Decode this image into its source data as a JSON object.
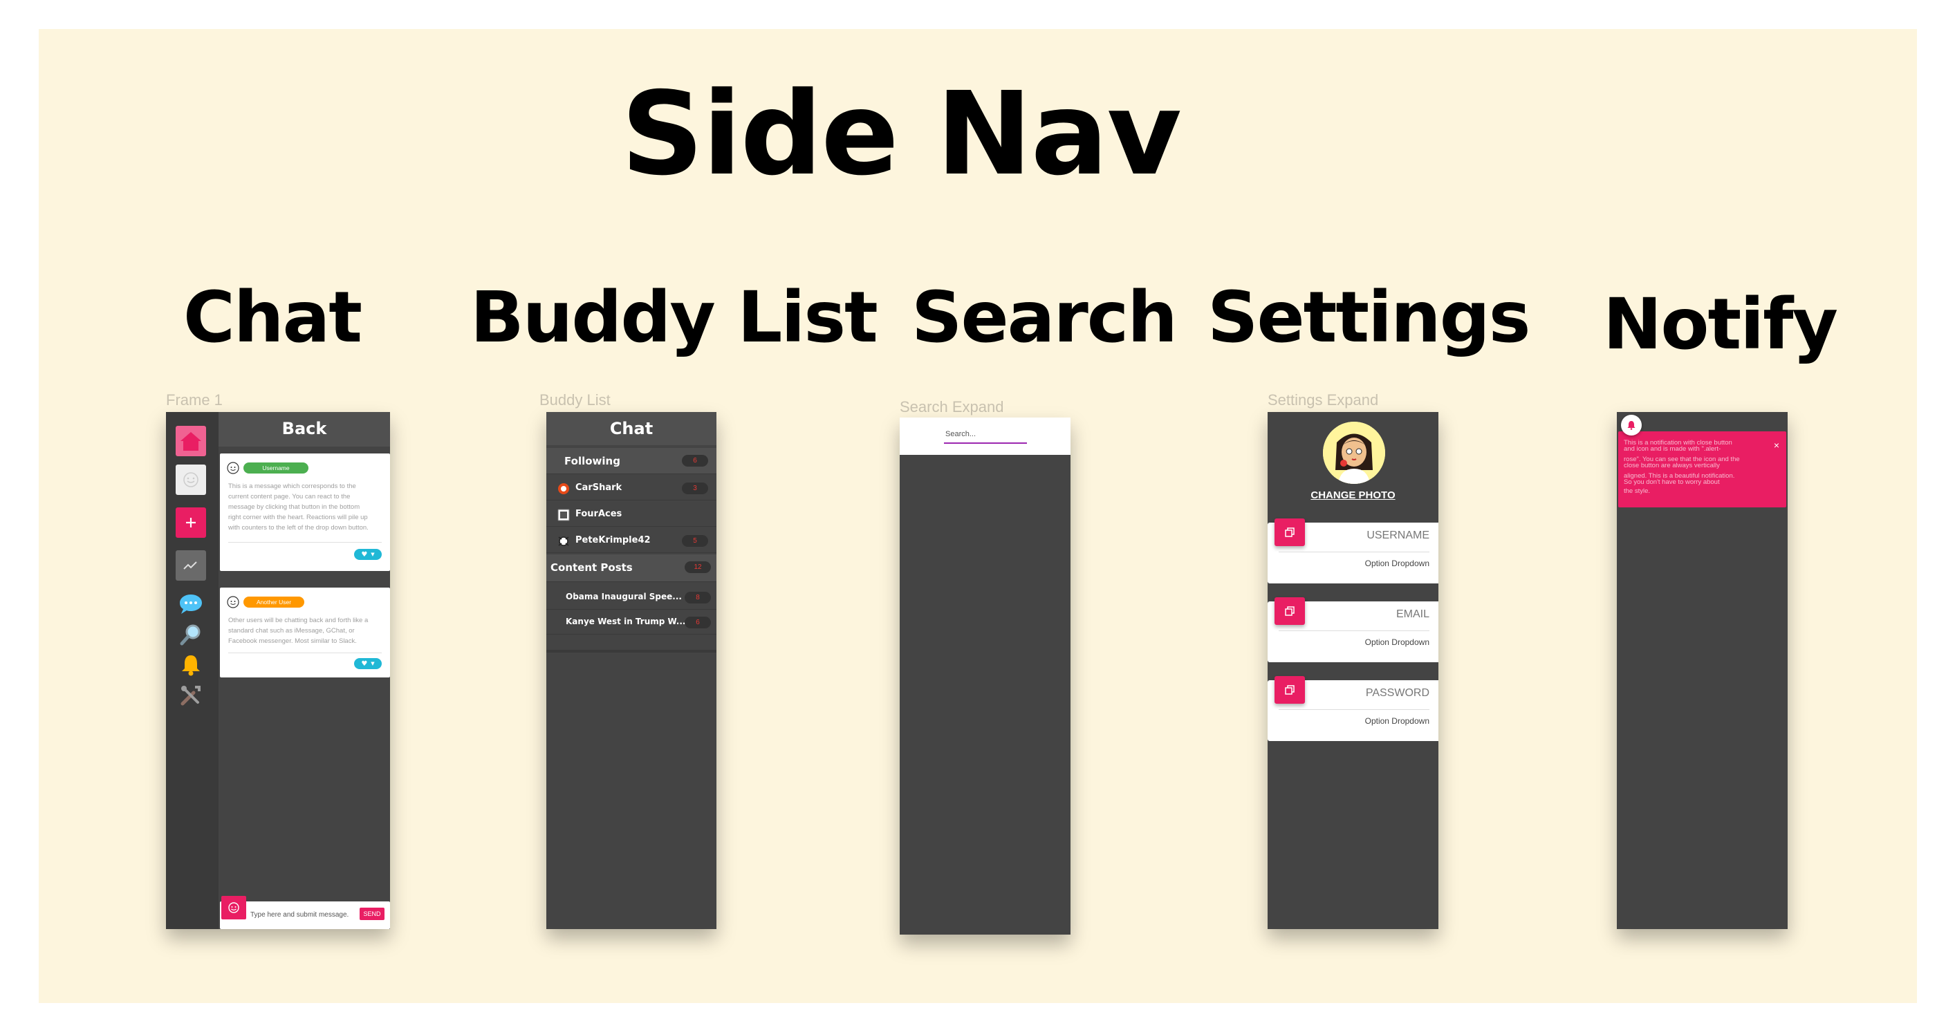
{
  "title": "Side Nav",
  "sections": {
    "chat": "Chat",
    "buddy": "Buddy List",
    "search": "Search",
    "settings": "Settings",
    "notify": "Notify"
  },
  "frames": {
    "chat": "Frame 1",
    "buddy": "Buddy List",
    "search": "Search Expand",
    "settings": "Settings Expand"
  },
  "chat_panel": {
    "back_label": "Back",
    "rail_icons": [
      "home-icon",
      "avatar",
      "plus-icon",
      "chart-icon",
      "speech-bubble-icon",
      "magnifier-icon",
      "bell-icon",
      "tools-icon"
    ],
    "messages": [
      {
        "user": "Username",
        "user_color": "#4caf50",
        "lines": [
          "This is a message which corresponds to the",
          "current content page.  You can react to the",
          "message by clicking that button in the bottom",
          "right corner with the heart. Reactions will pile up",
          "with counters to the left of the drop down button."
        ]
      },
      {
        "user": "Another User",
        "user_color": "#ff9800",
        "lines": [
          "Other users will be chatting back and forth like a",
          "standard chat such as iMessage, GChat, or",
          "Facebook messenger. Most similar to Slack."
        ]
      }
    ],
    "input_placeholder": "Type here and submit message.",
    "send_label": "SEND"
  },
  "buddy_panel": {
    "header": "Chat",
    "following": {
      "label": "Following",
      "count": "6"
    },
    "buddies": [
      {
        "name": "CarShark",
        "count": "3"
      },
      {
        "name": "FourAces",
        "count": ""
      },
      {
        "name": "PeteKrimple42",
        "count": "5"
      }
    ],
    "content": {
      "label": "Content Posts",
      "count": "12"
    },
    "posts": [
      {
        "title": "Obama Inaugural Spee...",
        "count": "8"
      },
      {
        "title": "Kanye West in Trump W...",
        "count": "6"
      }
    ]
  },
  "search_panel": {
    "placeholder": "Search..."
  },
  "settings_panel": {
    "change_photo": "CHANGE PHOTO",
    "fields": [
      {
        "label": "USERNAME",
        "option": "Option Dropdown"
      },
      {
        "label": "EMAIL",
        "option": "Option Dropdown"
      },
      {
        "label": "PASSWORD",
        "option": "Option Dropdown"
      }
    ]
  },
  "notify_panel": {
    "lines": [
      "This is a notification with close button",
      "and icon and is made with \".alert-",
      "rose\". You can see that the icon and the",
      "close button are always vertically",
      "aligned. This is a beautiful notification.",
      "So you don't have to worry about",
      "the style."
    ],
    "close": "×"
  },
  "colors": {
    "background": "#fdf5dd",
    "panel": "#444444",
    "accent": "#e91e63",
    "teal": "#20b8d6",
    "purple": "#9c27b0"
  }
}
